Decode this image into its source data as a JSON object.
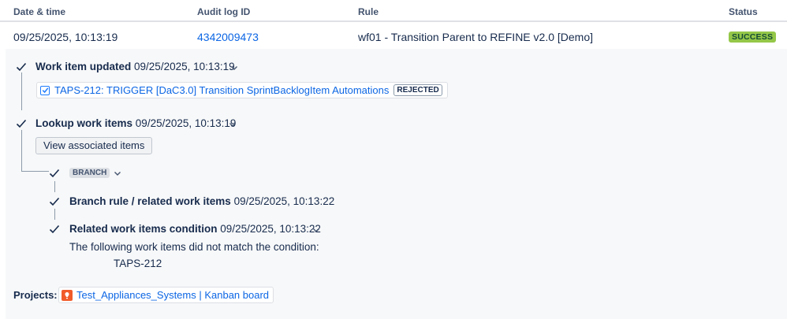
{
  "table": {
    "headers": {
      "date_time": "Date & time",
      "audit_log_id": "Audit log ID",
      "rule": "Rule",
      "status": "Status"
    },
    "row": {
      "date_time": "09/25/2025, 10:13:19",
      "audit_log_id": "4342009473",
      "rule": "wf01 - Transition Parent to REFINE v2.0 [Demo]",
      "status": "SUCCESS"
    }
  },
  "steps": {
    "work_item_updated": {
      "title": "Work item updated",
      "time": "09/25/2025, 10:13:19",
      "work_item": {
        "label": "TAPS-212: TRIGGER [DaC3.0] Transition SprintBacklogItem Automations",
        "badge": "REJECTED",
        "icon": "task-checkbox-icon"
      }
    },
    "lookup_work_items": {
      "title": "Lookup work items",
      "time": "09/25/2025, 10:13:19",
      "button": "View associated items"
    },
    "branch": {
      "label": "BRANCH",
      "branch_rule": {
        "title": "Branch rule / related work items",
        "time": "09/25/2025, 10:13:22"
      },
      "condition": {
        "title": "Related work items condition",
        "time": "09/25/2025, 10:13:22",
        "message": "The following work items did not match the condition:",
        "item": "TAPS-212"
      }
    }
  },
  "projects": {
    "label": "Projects:",
    "item": "Test_Appliances_Systems | Kanban board",
    "avatar_color": "#f15b2a"
  },
  "colors": {
    "link": "#0c66e4",
    "success_bg": "#94c748",
    "detail_bg": "#f7f8f9"
  }
}
